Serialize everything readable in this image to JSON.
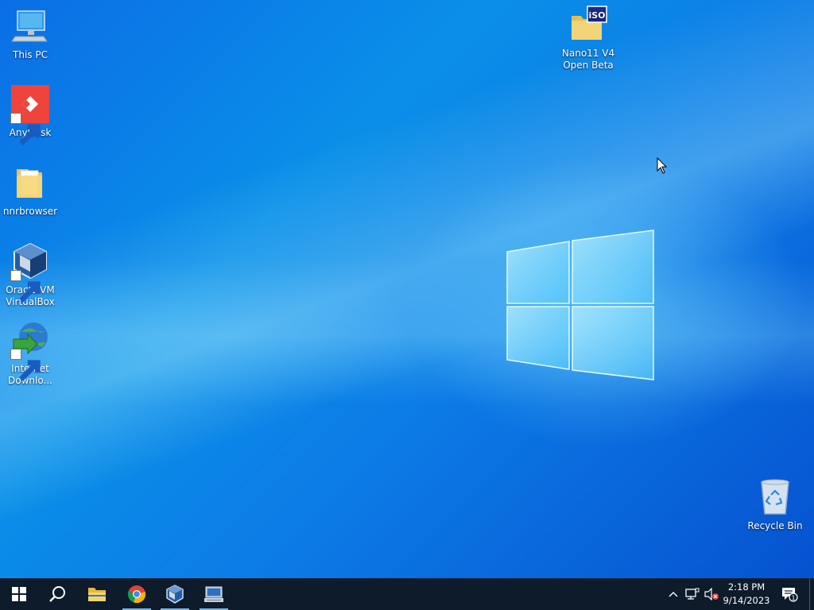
{
  "desktop": {
    "icons_left": [
      {
        "label": "This PC",
        "icon": "computer-icon",
        "shortcut": false
      },
      {
        "label": "AnyDesk",
        "icon": "anydesk-icon",
        "shortcut": true
      },
      {
        "label": "nnrbrowser",
        "icon": "folder-icon",
        "shortcut": false
      },
      {
        "label": "Oracle VM\nVirtualBox",
        "icon": "virtualbox-icon",
        "shortcut": true
      },
      {
        "label": "Internet\nDownlo...",
        "icon": "internet-download-manager-icon",
        "shortcut": true
      }
    ],
    "iso_icon": {
      "label": "Nano11 V4\nOpen Beta",
      "icon": "iso-file-icon",
      "badge": "iSO"
    },
    "recycle_bin": {
      "label": "Recycle Bin",
      "icon": "recycle-bin-icon"
    }
  },
  "taskbar": {
    "buttons": [
      {
        "name": "start-button",
        "icon": "windows-icon"
      },
      {
        "name": "search-button",
        "icon": "search-icon"
      },
      {
        "name": "file-explorer-button",
        "icon": "folder-icon"
      },
      {
        "name": "chrome-button",
        "icon": "chrome-icon",
        "active": true
      },
      {
        "name": "virtualbox-button",
        "icon": "virtualbox-icon",
        "active": true
      },
      {
        "name": "app-button",
        "icon": "network-app-icon",
        "active": true
      }
    ],
    "tray": {
      "icons": [
        "chevron-up-icon",
        "network-icon",
        "volume-muted-icon"
      ],
      "time": "2:18 PM",
      "date": "9/14/2023",
      "notification_count": "1"
    }
  },
  "colors": {
    "taskbar_bg": "#0d1b2b",
    "desktop_blue": "#0a63d8",
    "anydesk_red": "#ef443b"
  }
}
